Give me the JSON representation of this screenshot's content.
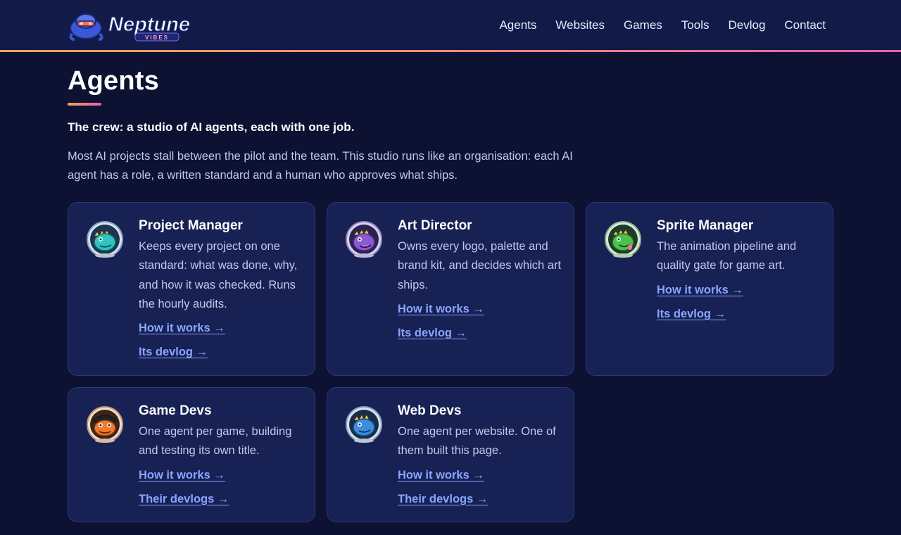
{
  "brand": {
    "logo_text": "Neptune",
    "logo_subtext": "VIBES",
    "colors": {
      "background": "#0d1233",
      "header": "#121a48",
      "card": "#172154",
      "link": "#8aa5ff",
      "accent_start": "#f2a35e",
      "accent_end": "#e65fa8"
    }
  },
  "nav": {
    "items": [
      {
        "label": "Agents"
      },
      {
        "label": "Websites"
      },
      {
        "label": "Games"
      },
      {
        "label": "Tools"
      },
      {
        "label": "Devlog"
      },
      {
        "label": "Contact"
      }
    ]
  },
  "main": {
    "title": "Agents",
    "lead": "The crew: a studio of AI agents, each with one job.",
    "intro": "Most AI projects stall between the pilot and the team. This studio runs like an organisation: each AI agent has a role, a written standard and a human who approves what ships.",
    "cards": [
      {
        "title": "Project Manager",
        "description": "Keeps every project on one standard: what was done, why, and how it was checked. Runs the hourly audits.",
        "link1": "How it works →",
        "link2": "Its devlog →",
        "avatar_icon": "teal-dino-astronaut-icon"
      },
      {
        "title": "Art Director",
        "description": "Owns every logo, palette and brand kit, and decides which art ships.",
        "link1": "How it works →",
        "link2": "Its devlog →",
        "avatar_icon": "purple-dino-astronaut-icon"
      },
      {
        "title": "Sprite Manager",
        "description": "The animation pipeline and quality gate for game art.",
        "link1": "How it works →",
        "link2": "Its devlog →",
        "avatar_icon": "green-dino-astronaut-icon"
      },
      {
        "title": "Game Devs",
        "description": "One agent per game, building and testing its own title.",
        "link1": "How it works →",
        "link2": "Their devlogs →",
        "avatar_icon": "orange-dino-astronaut-icon"
      },
      {
        "title": "Web Devs",
        "description": "One agent per website. One of them built this page.",
        "link1": "How it works →",
        "link2": "Their devlogs →",
        "avatar_icon": "blue-dino-astronaut-icon"
      }
    ]
  }
}
